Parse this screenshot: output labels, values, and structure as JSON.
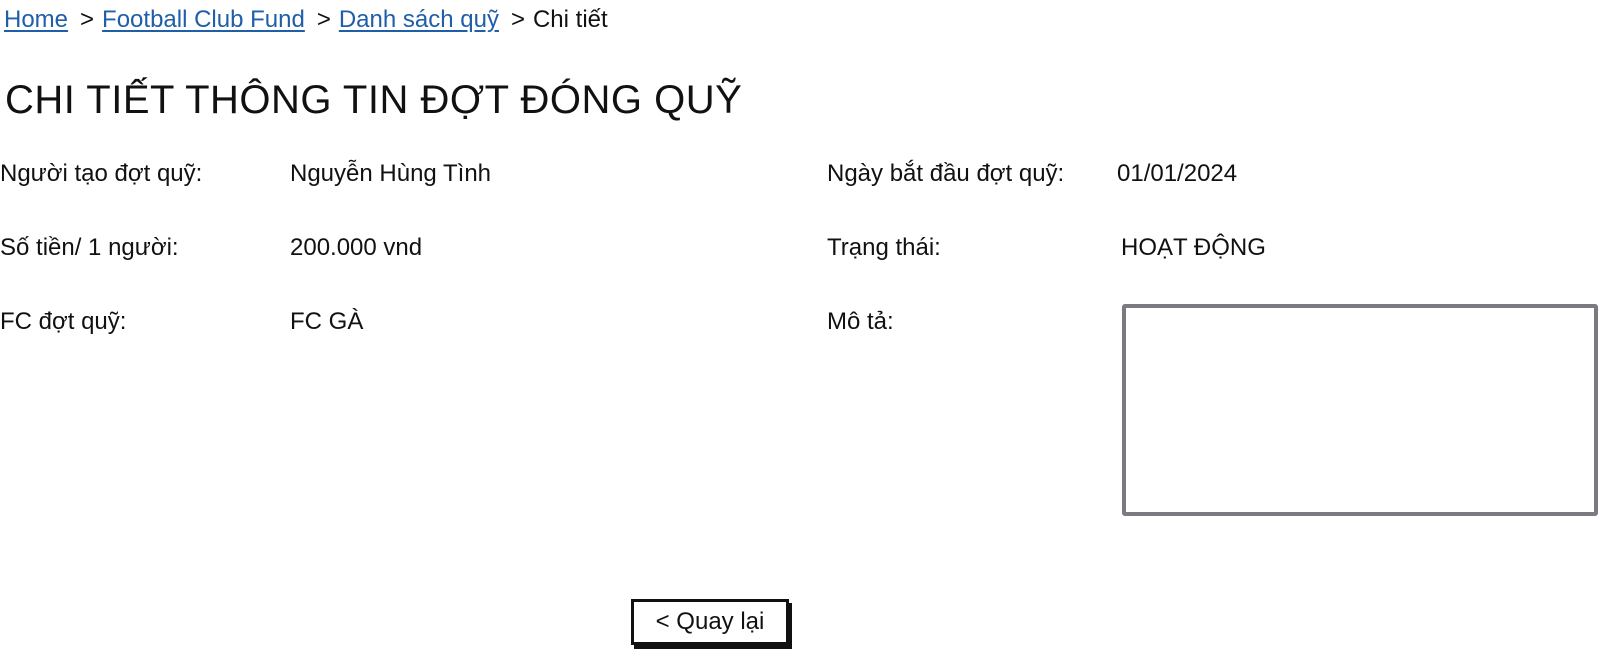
{
  "breadcrumb": {
    "items": [
      {
        "label": "Home"
      },
      {
        "label": "Football Club Fund"
      },
      {
        "label": "Danh sách quỹ"
      }
    ],
    "separator": ">",
    "current": "Chi tiết"
  },
  "page": {
    "title": "CHI TIẾT THÔNG TIN ĐỢT ĐÓNG QUỸ"
  },
  "details": {
    "creator": {
      "label": "Người tạo đợt quỹ:",
      "value": "Nguyễn Hùng Tình"
    },
    "start_date": {
      "label": "Ngày bắt đầu đợt quỹ:",
      "value": "01/01/2024"
    },
    "amount": {
      "label": "Số tiền/ 1 người:",
      "value": "200.000 vnd"
    },
    "status": {
      "label": "Trạng thái:",
      "value": "HOẠT ĐỘNG"
    },
    "fc": {
      "label": "FC đợt quỹ:",
      "value": "FC GÀ"
    },
    "description": {
      "label": "Mô tả:",
      "value": ""
    }
  },
  "actions": {
    "back_label": "< Quay lại"
  }
}
